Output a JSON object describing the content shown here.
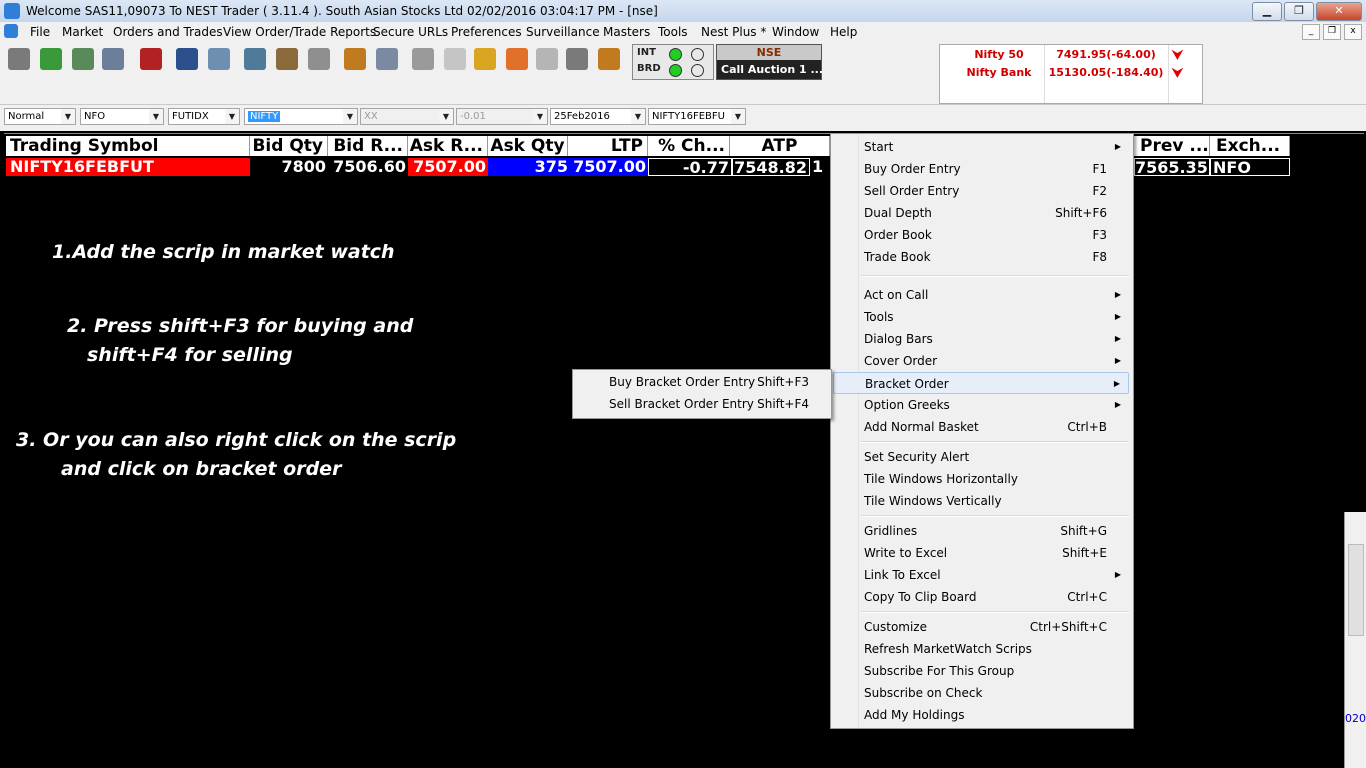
{
  "window": {
    "title": "Welcome SAS11,09073 To NEST Trader ( 3.11.4 ).  South Asian Stocks Ltd   02/02/2016  03:04:17 PM - [nse]",
    "minimize": "▁",
    "restore": "❐",
    "close": "✕"
  },
  "menubar": {
    "items": [
      "File",
      "Market",
      "Orders and Trades",
      "View Order/Trade Reports",
      "Secure URLs",
      "Preferences",
      "Surveillance",
      "Masters",
      "Tools",
      "Nest Plus *",
      "Window",
      "Help"
    ],
    "mdi_min": "_",
    "mdi_restore": "❐",
    "mdi_close": "x"
  },
  "status": {
    "int_label": "INT",
    "brd_label": "BRD",
    "exchange": "NSE",
    "session": "Call Auction 1 ...",
    "connected_color": "#22cc22",
    "idle_color": "#e8e8e8"
  },
  "indices": [
    {
      "name": "Nifty 50",
      "value": "7491.95(-64.00)",
      "trend": "⮟"
    },
    {
      "name": "Nifty Bank",
      "value": "15130.05(-184.40)",
      "trend": "⮟"
    }
  ],
  "filters": {
    "order_type": "Normal",
    "exchange_segment": "NFO",
    "instrument": "FUTIDX",
    "symbol": "NIFTY",
    "option_type": "XX",
    "strike": "-0.01",
    "expiry": "25Feb2016",
    "contract": "NIFTY16FEBFU"
  },
  "market_watch": {
    "columns": [
      "Trading Symbol",
      "Bid Qty",
      "Bid R...",
      "Ask R...",
      "Ask Qty",
      "LTP",
      "% Ch...",
      "ATP",
      "Prev ...",
      "Exch..."
    ],
    "row": {
      "symbol": "NIFTY16FEBFUT",
      "bid_qty": "7800",
      "bid_rate": "7506.60",
      "ask_rate": "7507.00",
      "ask_qty": "375",
      "ltp": "7507.00",
      "pct_change": "-0.77",
      "atp": "7548.82",
      "atp_overflow": "1",
      "prev_close": "7565.35",
      "exchange": "NFO"
    }
  },
  "instructions": {
    "step1": "1.Add the scrip in market watch",
    "step2_line1": "2. Press shift+F3 for buying and",
    "step2_line2": "shift+F4 for selling",
    "step3_line1": "3. Or you can also right click on the scrip",
    "step3_line2": "and click on bracket order"
  },
  "context_menu": {
    "items": [
      {
        "label": "Start",
        "shortcut": "",
        "submenu": true
      },
      {
        "label": "Buy Order Entry",
        "shortcut": "F1",
        "submenu": false
      },
      {
        "label": "Sell Order Entry",
        "shortcut": "F2",
        "submenu": false
      },
      {
        "label": "Dual Depth",
        "shortcut": "Shift+F6",
        "submenu": false
      },
      {
        "label": "Order Book",
        "shortcut": "F3",
        "submenu": false
      },
      {
        "label": "Trade Book",
        "shortcut": "F8",
        "submenu": false
      },
      {
        "label": "Act on Call",
        "shortcut": "",
        "submenu": true
      },
      {
        "label": "Tools",
        "shortcut": "",
        "submenu": true
      },
      {
        "label": "Dialog Bars",
        "shortcut": "",
        "submenu": true
      },
      {
        "label": "Cover Order",
        "shortcut": "",
        "submenu": true
      },
      {
        "label": "Bracket Order",
        "shortcut": "",
        "submenu": true
      },
      {
        "label": "Option Greeks",
        "shortcut": "",
        "submenu": true
      },
      {
        "label": "Add Normal Basket",
        "shortcut": "Ctrl+B",
        "submenu": false
      },
      {
        "label": "Set Security Alert",
        "shortcut": "",
        "submenu": false
      },
      {
        "label": "Tile Windows Horizontally",
        "shortcut": "",
        "submenu": false
      },
      {
        "label": "Tile Windows Vertically",
        "shortcut": "",
        "submenu": false
      },
      {
        "label": "Gridlines",
        "shortcut": "Shift+G",
        "submenu": false
      },
      {
        "label": "Write to Excel",
        "shortcut": "Shift+E",
        "submenu": false
      },
      {
        "label": "Link To Excel",
        "shortcut": "",
        "submenu": true
      },
      {
        "label": "Copy To Clip Board",
        "shortcut": "Ctrl+C",
        "submenu": false
      },
      {
        "label": "Customize",
        "shortcut": "Ctrl+Shift+C",
        "submenu": false
      },
      {
        "label": "Refresh MarketWatch Scrips",
        "shortcut": "",
        "submenu": false
      },
      {
        "label": "Subscribe For This Group",
        "shortcut": "",
        "submenu": false
      },
      {
        "label": "Subscribe on Check",
        "shortcut": "",
        "submenu": false
      },
      {
        "label": "Add My Holdings",
        "shortcut": "",
        "submenu": false
      }
    ],
    "submenu_arrow": "▶"
  },
  "bracket_submenu": {
    "items": [
      {
        "label": "Buy Bracket Order Entry",
        "shortcut": "Shift+F3"
      },
      {
        "label": "Sell Bracket Order Entry",
        "shortcut": "Shift+F4"
      }
    ]
  },
  "background_window": {
    "partial_text": "020"
  },
  "colors": {
    "symbol_bg": "#ff0000",
    "ask_qty_bg": "#0000ff",
    "index_text": "#d00000"
  }
}
